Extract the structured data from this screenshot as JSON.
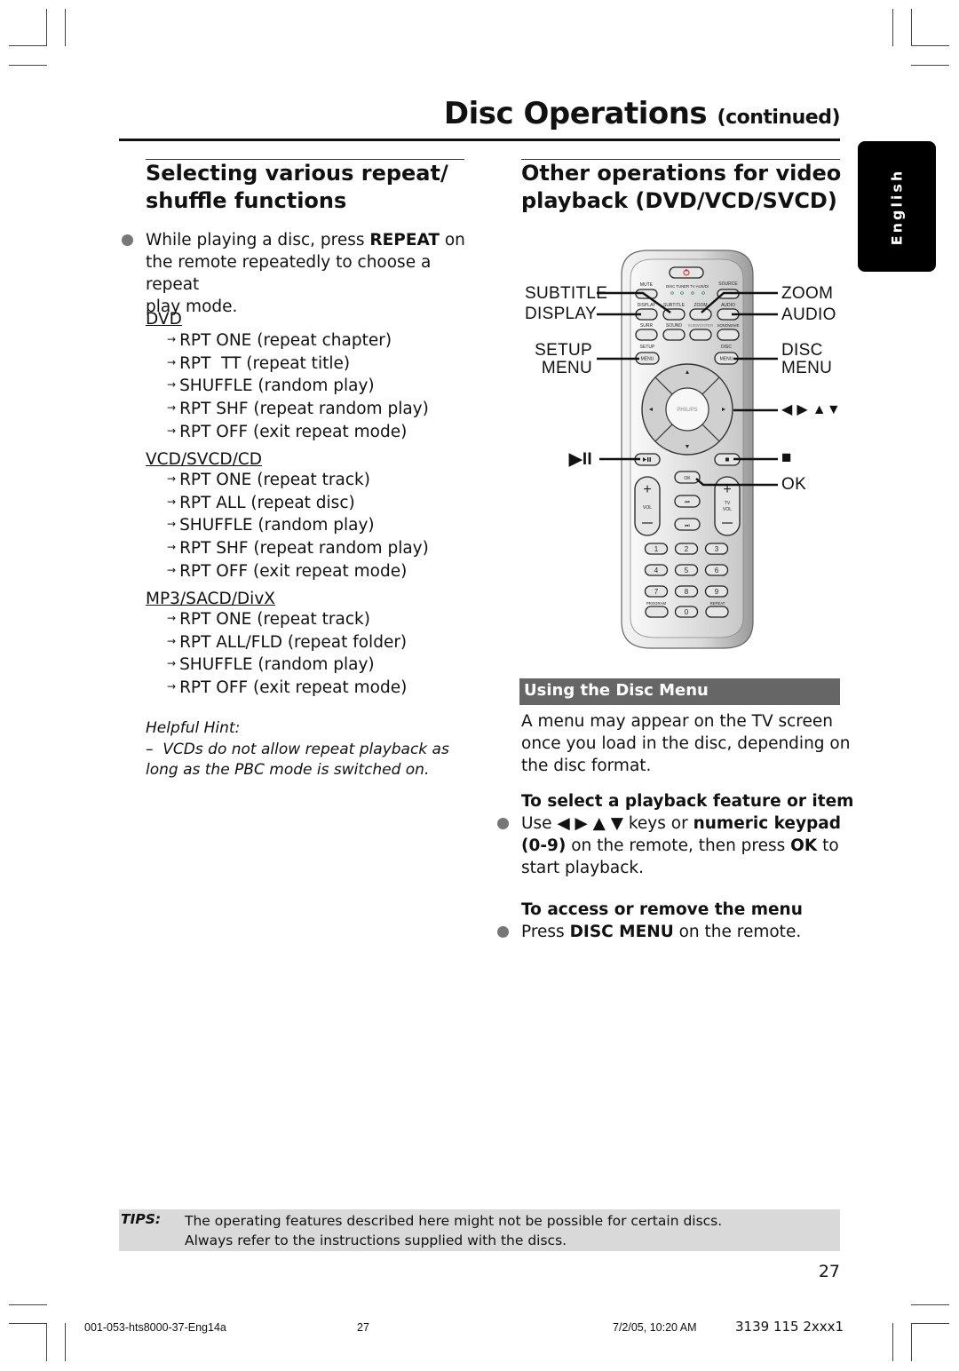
{
  "header": {
    "title": "Disc Operations",
    "title_suffix": "(continued)",
    "language_tab": "English"
  },
  "left_section": {
    "heading_line1": "Selecting various repeat/",
    "heading_line2": "shuffle functions",
    "intro": {
      "pre": "While playing a disc, press ",
      "key": "REPEAT",
      "post_line1": " on",
      "line2": "the remote repeatedly to choose a repeat",
      "line3": "play mode."
    },
    "categories": [
      {
        "label": "DVD",
        "modes": [
          "RPT ONE (repeat chapter)",
          "RPT  TT (repeat title)",
          "SHUFFLE (random play)",
          "RPT SHF (repeat random play)",
          "RPT OFF (exit repeat mode)"
        ]
      },
      {
        "label": "VCD/SVCD/CD",
        "modes": [
          "RPT ONE (repeat track)",
          "RPT ALL (repeat disc)",
          "SHUFFLE (random play)",
          "RPT SHF (repeat random play)",
          "RPT OFF (exit repeat mode)"
        ]
      },
      {
        "label": "MP3/SACD/DivX",
        "modes": [
          "RPT ONE (repeat track)",
          "RPT ALL/FLD (repeat folder)",
          "SHUFFLE (random play)",
          "RPT OFF (exit repeat mode)"
        ]
      }
    ],
    "hint_title": "Helpful Hint:",
    "hint_line1": "–  VCDs do not allow repeat playback as",
    "hint_line2": "long as the PBC mode is switched on."
  },
  "right_section": {
    "heading_line1": "Other operations for video",
    "heading_line2": "playback (DVD/VCD/SVCD)",
    "remote": {
      "brand": "PHILIPS",
      "callouts_left": [
        "SUBTITLE",
        "DISPLAY",
        "SETUP",
        "MENU",
        "▶II"
      ],
      "callouts_right": [
        "ZOOM",
        "AUDIO",
        "DISC",
        "MENU",
        "◀ ▶ ▲▼",
        "■",
        "OK"
      ],
      "button_labels": {
        "mute": "MUTE",
        "source": "SOURCE",
        "sources": "DISC TUNER  TV  AUX/DI",
        "display": "DISPLAY",
        "subtitle": "SUBTITLE",
        "zoom": "ZOOM",
        "audio": "AUDIO",
        "surr": "SURR",
        "sound": "SOUND",
        "subwoofer": "SUBWOOFER",
        "sonowave": "SONOWAVE",
        "setup": "SETUP",
        "disc": "DISC",
        "menu": "MENU",
        "ok": "OK",
        "vol": "VOL",
        "tv_vol_1": "TV",
        "tv_vol_2": "VOL",
        "program": "PROGRAM",
        "repeat": "REPEAT",
        "digits": [
          "1",
          "2",
          "3",
          "4",
          "5",
          "6",
          "7",
          "8",
          "9",
          "0"
        ]
      }
    },
    "subsection_title": "Using the Disc Menu",
    "intro_lines": [
      "A menu may appear on the TV screen",
      "once you load in the disc, depending on",
      "the disc format."
    ],
    "step1": {
      "title": "To select a playback feature or item",
      "line1_pre": "Use ◀ ▶ ▲ ▼ keys or ",
      "line1_bold": "numeric keypad",
      "line2_bold": "(0-9)",
      "line2_mid": " on the remote, then press ",
      "line2_bold2": "OK",
      "line2_post": " to",
      "line3": "start playback."
    },
    "step2": {
      "title": "To access or remove the menu",
      "pre": "Press ",
      "bold": "DISC MENU",
      "post": " on the remote."
    }
  },
  "tips": {
    "label": "TIPS:",
    "line1": "The operating features described here might not be possible for certain discs.",
    "line2": "Always refer to the instructions supplied with the discs."
  },
  "page_number": "27",
  "footer": {
    "file": "001-053-hts8000-37-Eng14a",
    "page": "27",
    "date": "7/2/05, 10:20 AM",
    "code": "3139 115 2xxx1"
  }
}
